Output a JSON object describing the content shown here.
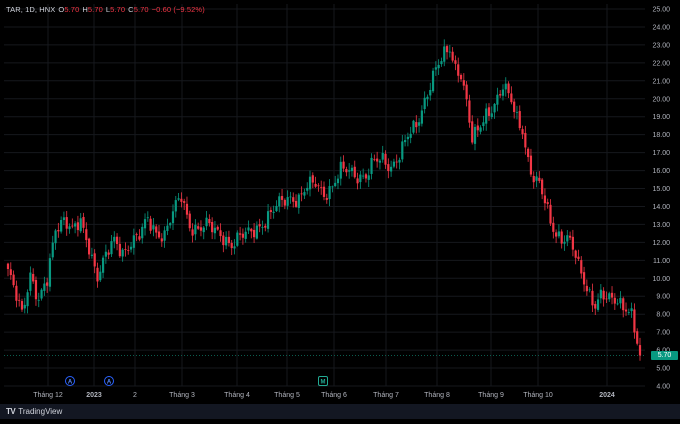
{
  "header": {
    "symbol": "TAR, 1D, HNX",
    "open_label": "O",
    "open": "5.70",
    "high_label": "H",
    "high": "5.70",
    "low_label": "L",
    "low": "5.70",
    "close_label": "C",
    "close": "5.70",
    "change": "−0.60 (−9.52%)"
  },
  "last_price_tag": "5.70",
  "footer": {
    "brand": "TradingView",
    "logo_icon": "tradingview-logo-icon"
  },
  "colors": {
    "up": "#089981",
    "down": "#f23645",
    "background": "#000000",
    "grid": "#16181d",
    "axis_text": "#b2b5be"
  },
  "chart_data": {
    "type": "candlestick",
    "yaxis_ticks": [
      "4.00",
      "5.00",
      "6.00",
      "7.00",
      "8.00",
      "9.00",
      "10.00",
      "11.00",
      "12.00",
      "13.00",
      "14.00",
      "15.00",
      "16.00",
      "17.00",
      "18.00",
      "19.00",
      "20.00",
      "21.00",
      "22.00",
      "23.00",
      "24.00",
      "25.00"
    ],
    "ylim": [
      4,
      25
    ],
    "yaxis_side": "right",
    "xaxis_labels": [
      "Tháng 12",
      "2023",
      "2",
      "Tháng 3",
      "Tháng 4",
      "Tháng 5",
      "Tháng 6",
      "Tháng 7",
      "Tháng 8",
      "Tháng 9",
      "Tháng 10",
      "2024"
    ],
    "event_markers": [
      {
        "label": "A",
        "after_label": "Tháng 12",
        "kind": "dividend"
      },
      {
        "label": "A",
        "after_label": "2023",
        "kind": "dividend"
      },
      {
        "label": "M",
        "after_label": "Tháng 6",
        "kind": "meeting"
      }
    ],
    "last_close": 5.7,
    "close_path": [
      [
        0,
        10.2
      ],
      [
        3,
        9.0
      ],
      [
        5,
        8.2
      ],
      [
        8,
        10.3
      ],
      [
        11,
        8.6
      ],
      [
        14,
        9.8
      ],
      [
        17,
        12.9
      ],
      [
        20,
        13.4
      ],
      [
        23,
        12.6
      ],
      [
        26,
        13.0
      ],
      [
        29,
        11.8
      ],
      [
        32,
        10.2
      ],
      [
        35,
        11.2
      ],
      [
        38,
        12.0
      ],
      [
        41,
        11.5
      ],
      [
        44,
        12.1
      ],
      [
        47,
        12.3
      ],
      [
        50,
        13.2
      ],
      [
        53,
        12.6
      ],
      [
        56,
        12.5
      ],
      [
        59,
        13.6
      ],
      [
        62,
        14.5
      ],
      [
        65,
        13.0
      ],
      [
        68,
        12.8
      ],
      [
        71,
        12.9
      ],
      [
        74,
        12.6
      ],
      [
        77,
        12.4
      ],
      [
        80,
        11.9
      ],
      [
        83,
        12.2
      ],
      [
        86,
        12.5
      ],
      [
        89,
        12.9
      ],
      [
        92,
        13.2
      ],
      [
        95,
        13.7
      ],
      [
        98,
        14.3
      ],
      [
        101,
        14.6
      ],
      [
        104,
        14.4
      ],
      [
        107,
        15.0
      ],
      [
        110,
        15.3
      ],
      [
        113,
        14.8
      ],
      [
        116,
        15.1
      ],
      [
        119,
        15.9
      ],
      [
        122,
        16.0
      ],
      [
        125,
        15.8
      ],
      [
        128,
        15.7
      ],
      [
        131,
        16.4
      ],
      [
        134,
        16.6
      ],
      [
        137,
        16.3
      ],
      [
        140,
        16.9
      ],
      [
        143,
        17.8
      ],
      [
        146,
        18.5
      ],
      [
        149,
        20.0
      ],
      [
        152,
        21.3
      ],
      [
        155,
        22.1
      ],
      [
        158,
        22.8
      ],
      [
        160,
        21.8
      ],
      [
        162,
        21.5
      ],
      [
        164,
        19.8
      ],
      [
        166,
        17.6
      ],
      [
        168,
        18.1
      ],
      [
        171,
        19.2
      ],
      [
        174,
        19.8
      ],
      [
        177,
        20.6
      ],
      [
        180,
        19.8
      ],
      [
        182,
        18.9
      ],
      [
        184,
        18.4
      ],
      [
        186,
        16.6
      ],
      [
        188,
        15.5
      ],
      [
        190,
        15.1
      ],
      [
        192,
        14.2
      ],
      [
        194,
        13.2
      ],
      [
        196,
        12.6
      ],
      [
        198,
        12.3
      ],
      [
        200,
        12.2
      ],
      [
        202,
        11.6
      ],
      [
        204,
        10.6
      ],
      [
        206,
        9.9
      ],
      [
        208,
        9.2
      ],
      [
        210,
        8.6
      ],
      [
        212,
        9.0
      ],
      [
        215,
        8.7
      ],
      [
        218,
        8.8
      ],
      [
        221,
        8.5
      ],
      [
        223,
        8.0
      ],
      [
        225,
        6.3
      ],
      [
        226,
        5.7
      ]
    ]
  }
}
